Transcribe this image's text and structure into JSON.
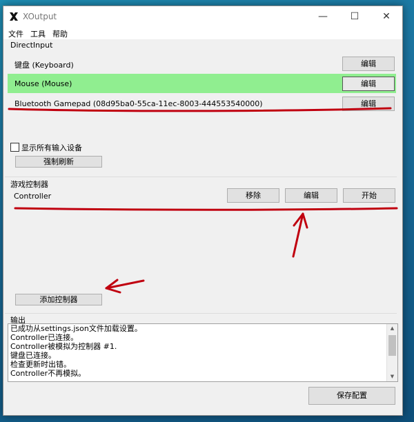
{
  "window": {
    "title": "XOutput"
  },
  "menu": {
    "items": [
      "文件",
      "工具",
      "帮助"
    ]
  },
  "directinput": {
    "label": "DirectInput",
    "devices": [
      {
        "name": "键盘 (Keyboard)",
        "button": "编辑"
      },
      {
        "name": "Mouse (Mouse)",
        "button": "编辑",
        "selected": true
      },
      {
        "name": "Bluetooth Gamepad  (08d95ba0-55ca-11ec-8003-444553540000)",
        "button": "编辑"
      }
    ],
    "show_all_label": "显示所有输入设备",
    "show_all_checked": false,
    "refresh_button": "强制刷新"
  },
  "controllers": {
    "label": "游戏控制器",
    "items": [
      {
        "name": "Controller",
        "remove": "移除",
        "edit": "编辑",
        "start": "开始"
      }
    ],
    "add_button": "添加控制器"
  },
  "output": {
    "label": "输出",
    "lines": [
      "已成功从settings.json文件加载设置。",
      "Controller已连接。",
      "Controller被模拟为控制器 #1.",
      "键盘已连接。",
      "检查更新时出错。",
      "Controller不再模拟。"
    ]
  },
  "save_button": "保存配置",
  "colors": {
    "selected_row": "#90ee90",
    "annotation": "#c0000f"
  }
}
